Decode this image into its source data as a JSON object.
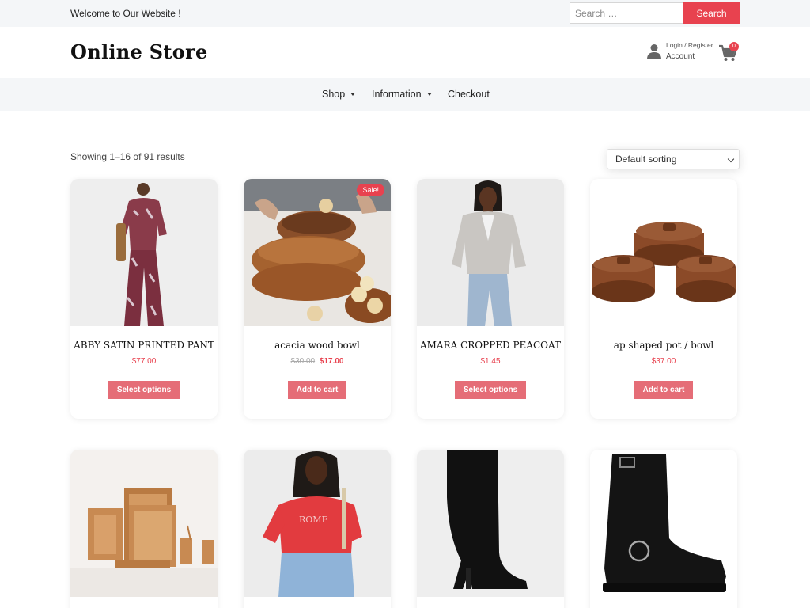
{
  "topbar": {
    "welcome": "Welcome to Our Website !",
    "search_placeholder": "Search …",
    "search_button": "Search"
  },
  "header": {
    "logo": "Online Store",
    "login_register": "Login / Register",
    "account": "Account",
    "cart_count": "0"
  },
  "nav": {
    "items": [
      {
        "label": "Shop",
        "dropdown": true
      },
      {
        "label": "Information",
        "dropdown": true
      },
      {
        "label": "Checkout",
        "dropdown": false
      }
    ]
  },
  "catalog": {
    "results_text": "Showing 1–16 of 91 results",
    "sort_selected": "Default sorting"
  },
  "colors": {
    "accent": "#e8424f",
    "button": "#e56d77",
    "topbar_bg": "#f4f6f8"
  },
  "products": [
    {
      "title": "ABBY SATIN PRINTED PANT",
      "price": "$77.00",
      "button": "Select options",
      "image": "woman-in-printed-satin-set"
    },
    {
      "title": "acacia wood bowl",
      "old_price": "$30.00",
      "price": "$17.00",
      "sale_badge": "Sale!",
      "button": "Add to cart",
      "image": "wooden-bowls"
    },
    {
      "title": "AMARA CROPPED PEACOAT",
      "price": "$1.45",
      "button": "Select options",
      "image": "woman-in-grey-peacoat"
    },
    {
      "title": "ap shaped pot / bowl",
      "price": "$37.00",
      "button": "Add to cart",
      "image": "brown-clay-pots"
    },
    {
      "title": "",
      "image": "wooden-trays"
    },
    {
      "title": "",
      "image": "woman-in-red-tshirt"
    },
    {
      "title": "",
      "image": "black-knee-high-boot"
    },
    {
      "title": "",
      "image": "black-biker-boot"
    }
  ]
}
